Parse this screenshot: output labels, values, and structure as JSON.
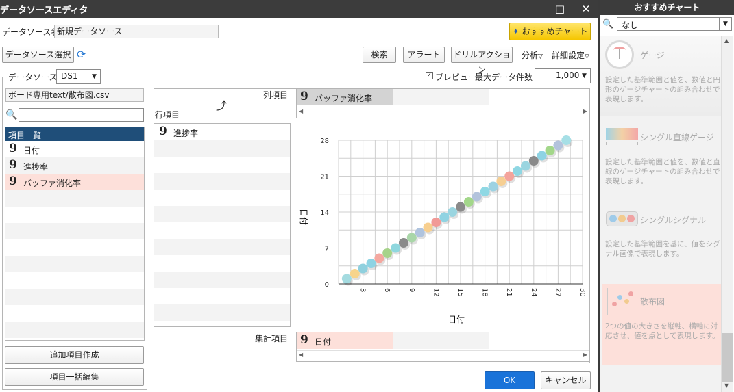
{
  "dialog": {
    "title": "データソースエディタ",
    "maximize_icon": "maximize-icon",
    "close_icon": "close-icon"
  },
  "datasource_name": {
    "label": "データソース名",
    "value": "新規データソース"
  },
  "recommend_button": "おすすめチャート",
  "select_datasource_button": "データソース選択",
  "toolbar": {
    "search": "検索",
    "alert": "アラート",
    "drill": "ドリルアクション",
    "analysis": "分析",
    "detail": "詳細設定"
  },
  "datasource": {
    "label": "データソース",
    "value": "DS1",
    "file": "ボード専用text/散布図.csv"
  },
  "preview": {
    "label": "プレビュー",
    "checked": true
  },
  "max_rows": {
    "label": "最大データ件数",
    "value": "1,000"
  },
  "items_list": {
    "header": "項目一覧",
    "items": [
      {
        "label": "日付",
        "highlight": false
      },
      {
        "label": "進捗率",
        "highlight": false
      },
      {
        "label": "バッファ消化率",
        "highlight": true
      }
    ]
  },
  "add_item_button": "追加項目作成",
  "bulk_edit_button": "項目一括編集",
  "columns": {
    "label": "列項目",
    "item": "バッファ消化率"
  },
  "rows": {
    "label": "行項目",
    "item": "進捗率"
  },
  "aggregate": {
    "label": "集計項目",
    "item": "日付"
  },
  "ok_button": "OK",
  "cancel_button": "キャンセル",
  "chart_data": {
    "type": "scatter",
    "xlabel": "日付",
    "ylabel": "日付",
    "xticks": [
      "3",
      "6",
      "9",
      "12",
      "15",
      "18",
      "21",
      "24",
      "27",
      "30"
    ],
    "yticks": [
      "0",
      "7",
      "14",
      "21",
      "28"
    ],
    "xlim": [
      0,
      30
    ],
    "ylim": [
      0,
      28
    ],
    "grid": true,
    "x": [
      1,
      2,
      3,
      4,
      5,
      6,
      7,
      8,
      9,
      10,
      11,
      12,
      13,
      14,
      15,
      16,
      17,
      18,
      19,
      20,
      21,
      22,
      23,
      24,
      25,
      26,
      27,
      28
    ],
    "y": [
      1,
      2,
      3,
      4,
      5,
      6,
      7,
      8,
      9,
      10,
      11,
      12,
      13,
      14,
      15,
      16,
      17,
      18,
      19,
      20,
      21,
      22,
      23,
      24,
      25,
      26,
      27,
      28
    ],
    "colors": [
      "#a4dbe0",
      "#f7d48c",
      "#8fd0de",
      "#8ed3e3",
      "#f4a8a0",
      "#a6d38a",
      "#8fd7de",
      "#8a8a8a",
      "#a9d6a8",
      "#b0c4de",
      "#f7cf8f",
      "#f19a97",
      "#8fd3e2",
      "#9ad5e0",
      "#8a8a8a",
      "#a3d78a",
      "#b3c3dc",
      "#8fd8e4",
      "#9dd2e2",
      "#f6cf93",
      "#f4a49c",
      "#8fd7e3",
      "#9ad5e0",
      "#8a8a8a",
      "#8ed3e3",
      "#a3d78a",
      "#b3c3dc",
      "#a6dfe6"
    ]
  },
  "sidebar": {
    "title": "おすすめチャート",
    "search_value": "なし",
    "items": [
      {
        "name": "ゲージ",
        "desc": "設定した基準範囲と値を、数値と円形のゲージチャートの組み合わせで表現します。"
      },
      {
        "name": "シングル直線ゲージ",
        "desc": "設定した基準範囲と値を、数値と直線のゲージチャートの組み合わせで表現します。"
      },
      {
        "name": "シングルシグナル",
        "desc": "設定した基準範囲を基に、値をシグナル画像で表現します。"
      },
      {
        "name": "散布図",
        "desc": "2つの値の大きさを縦軸、横軸に対応させ、値を点として表現します。"
      }
    ]
  }
}
